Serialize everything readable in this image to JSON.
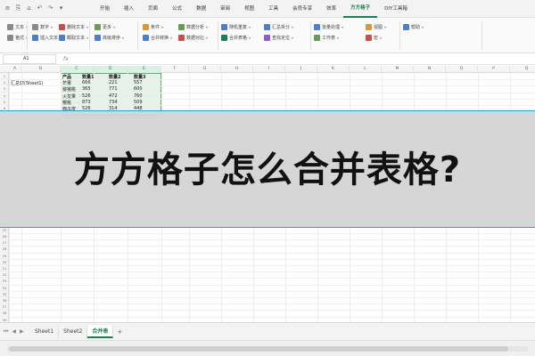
{
  "menubar": {
    "icons": [
      "≡",
      "⎘",
      "⌂",
      "↶",
      "↷",
      "▾"
    ],
    "tabs": [
      "开始",
      "插入",
      "页面",
      "公式",
      "数据",
      "审阅",
      "视图",
      "工具",
      "会员专享",
      "效率",
      "方方格子",
      "DIY工具箱"
    ],
    "active_tab": "方方格子"
  },
  "ribbon": {
    "items": [
      {
        "label": "文本",
        "color": "#8a8a8a"
      },
      {
        "label": "格式",
        "color": "#8a8a8a"
      },
      {
        "label": "数字",
        "color": "#8a8a8a"
      },
      {
        "label": "插入文本",
        "color": "#4f7fc7"
      },
      {
        "label": "删除文本",
        "color": "#c7504f"
      },
      {
        "label": "截取文本",
        "color": "#4f7fc7"
      },
      {
        "label": "更多",
        "color": "#6a9a5a"
      },
      {
        "label": "高级排序",
        "color": "#4f7fc7"
      },
      {
        "label": "条件",
        "color": "#d59a3a"
      },
      {
        "label": "合并转换",
        "color": "#4f7fc7"
      },
      {
        "label": "数据分析",
        "color": "#6a9a5a"
      },
      {
        "label": "数据对比",
        "color": "#c7504f"
      },
      {
        "label": "随机重复",
        "color": "#4f7fc7"
      },
      {
        "label": "合并表格",
        "color": "#1a7f52"
      },
      {
        "label": "汇总拆分",
        "color": "#4f7fc7"
      },
      {
        "label": "查找定位",
        "color": "#8a5fc7"
      },
      {
        "label": "批量处理",
        "color": "#4f7fc7"
      },
      {
        "label": "工作表",
        "color": "#6a9a5a"
      },
      {
        "label": "视图",
        "color": "#d59a3a"
      },
      {
        "label": "宏",
        "color": "#c7504f"
      },
      {
        "label": "帮助",
        "color": "#4f7fc7"
      }
    ]
  },
  "formula_bar": {
    "name_box": "A1",
    "fx": "fx",
    "value": ""
  },
  "grid": {
    "columns": [
      "A",
      "B",
      "C",
      "D",
      "E",
      "F",
      "G",
      "H",
      "I",
      "J",
      "K",
      "L",
      "M",
      "N",
      "O",
      "P",
      "Q"
    ],
    "selected_columns": [
      "C",
      "D",
      "E"
    ],
    "header_row": [
      "产品",
      "数量1",
      "数量2",
      "数量3"
    ],
    "rows": [
      [
        "芒果",
        "666",
        "221",
        "557"
      ],
      [
        "猕猴桃",
        "365",
        "771",
        "600"
      ],
      [
        "火龙果",
        "526",
        "472",
        "760"
      ],
      [
        "樱桃",
        "873",
        "734",
        "509"
      ],
      [
        "西瓜皮",
        "526",
        "314",
        "448"
      ]
    ],
    "side_label": "汇总表(Sheet1)"
  },
  "banner": {
    "title": "方方格子怎么合并表格?",
    "border_color": "#18aebc"
  },
  "sheets": {
    "tabs": [
      "Sheet1",
      "Sheet2",
      "合并表"
    ],
    "active": "合并表",
    "add": "+"
  }
}
